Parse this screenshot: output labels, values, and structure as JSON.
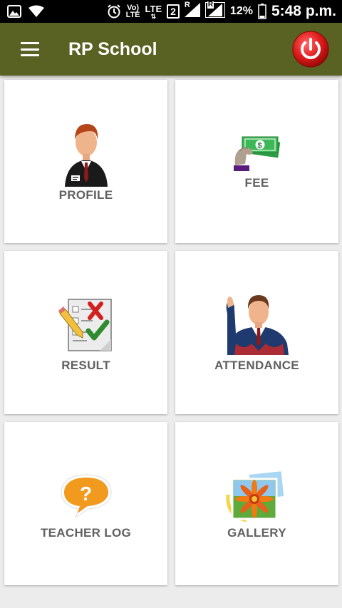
{
  "status_bar": {
    "volte": "Vo)",
    "volte_lte": "LTE",
    "lte": "LTE",
    "sim_number": "2",
    "roaming_1": "R",
    "roaming_2": "R",
    "battery": "12%",
    "time": "5:48 p.m."
  },
  "app_bar": {
    "title": "RP School",
    "power_color": "#e01b1b"
  },
  "tiles": [
    {
      "label": "PROFILE",
      "icon": "profile-icon"
    },
    {
      "label": "FEE",
      "icon": "fee-icon"
    },
    {
      "label": "RESULT",
      "icon": "result-icon"
    },
    {
      "label": "ATTENDANCE",
      "icon": "attendance-icon"
    },
    {
      "label": "TEACHER LOG",
      "icon": "teacher-log-icon"
    },
    {
      "label": "GALLERY",
      "icon": "gallery-icon"
    }
  ],
  "colors": {
    "app_bar": "#596123",
    "background": "#ececec",
    "tile": "#ffffff",
    "label": "#606060"
  }
}
